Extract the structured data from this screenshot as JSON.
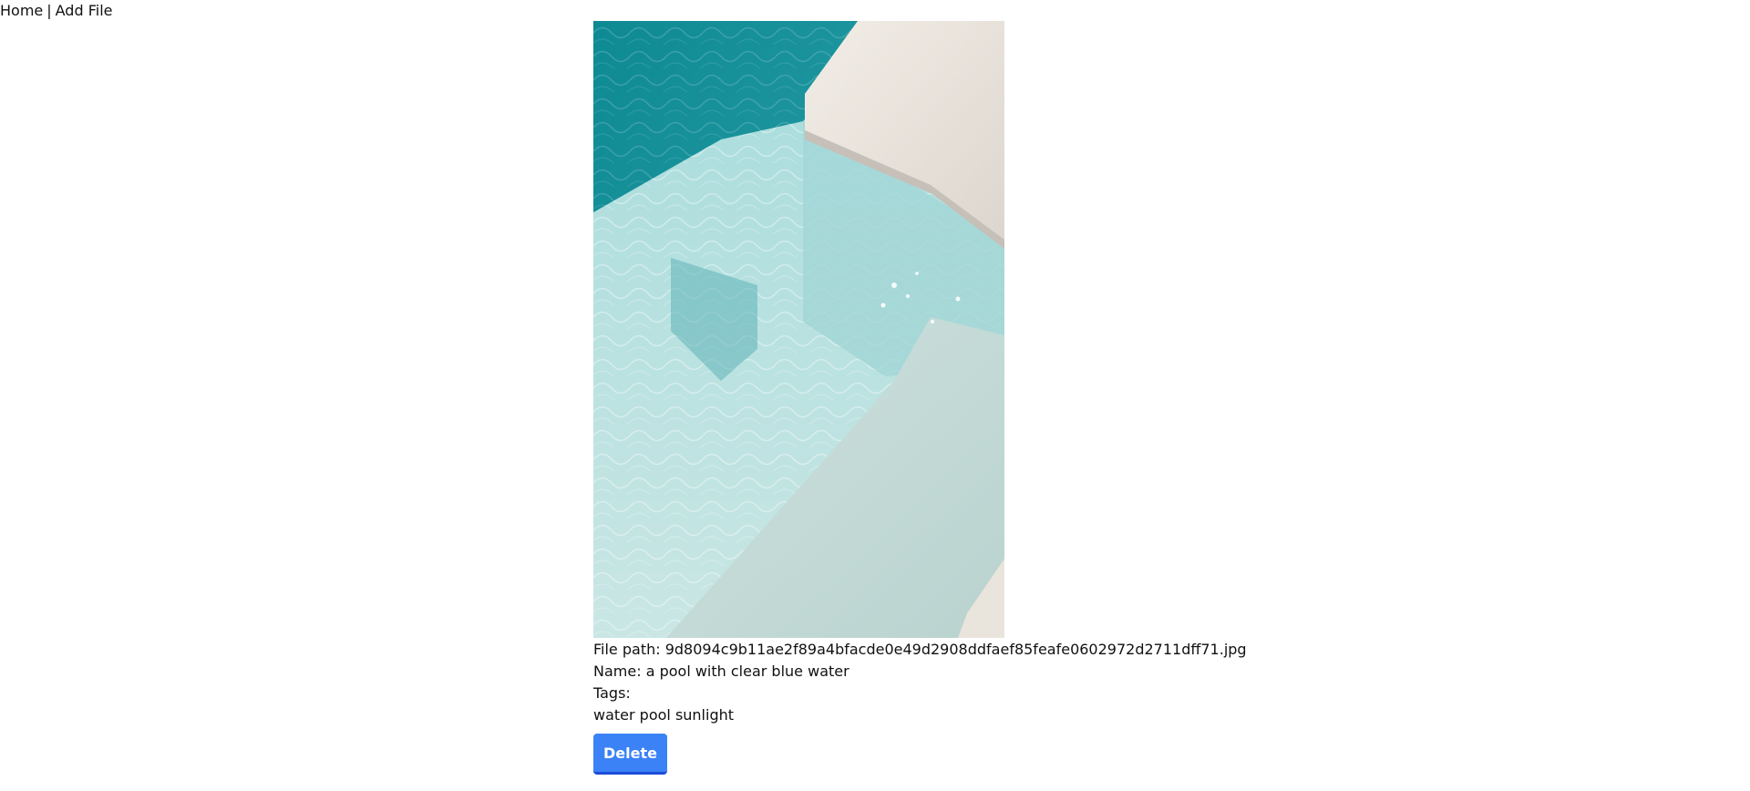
{
  "nav": {
    "home_label": "Home",
    "separator": "|",
    "add_file_label": "Add File"
  },
  "file": {
    "image_description_icon": "photo-pool-water",
    "path_label": "File path:",
    "path_value": "9d8094c9b11ae2f89a4bfacde0e49d2908ddfaef85feafe0602972d2711dff71.jpg",
    "name_label": "Name:",
    "name_value": "a pool with clear blue water",
    "tags_label": "Tags:",
    "tags_value": "water pool sunlight"
  },
  "actions": {
    "delete_label": "Delete"
  },
  "colors": {
    "button": "#3b82f6",
    "button_border": "#1d4ed8"
  }
}
